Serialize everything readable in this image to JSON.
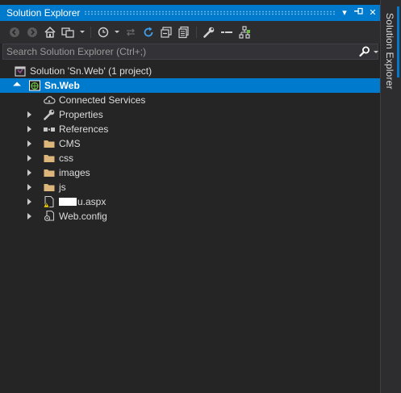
{
  "window": {
    "title": "Solution Explorer",
    "side_tab": "Solution Explorer"
  },
  "titlebar_buttons": [
    "dropdown",
    "pin",
    "close"
  ],
  "toolbar": {
    "icons": [
      "back-icon",
      "forward-icon",
      "home-icon",
      "switch-views-icon",
      "history-icon",
      "sync-icon",
      "refresh-icon",
      "collapse-all-icon",
      "show-all-files-icon",
      "properties-icon",
      "minus-icon",
      "preview-icon"
    ]
  },
  "search": {
    "placeholder": "Search Solution Explorer (Ctrl+;)",
    "value": ""
  },
  "tree": {
    "solution": "Solution 'Sn.Web' (1 project)",
    "project": "Sn.Web",
    "items": [
      {
        "label": "Connected Services",
        "icon": "cloud-icon"
      },
      {
        "label": "Properties",
        "icon": "wrench-icon"
      },
      {
        "label": "References",
        "icon": "references-icon"
      },
      {
        "label": "CMS",
        "icon": "folder-icon"
      },
      {
        "label": "css",
        "icon": "folder-icon"
      },
      {
        "label": "images",
        "icon": "folder-icon"
      },
      {
        "label": "js",
        "icon": "folder-icon"
      },
      {
        "label": "u.aspx",
        "icon": "aspx-file-warning-icon"
      },
      {
        "label": "Web.config",
        "icon": "config-file-icon"
      }
    ]
  },
  "colors": {
    "accent": "#007acc",
    "background": "#252526",
    "folder": "#dcb67a"
  }
}
